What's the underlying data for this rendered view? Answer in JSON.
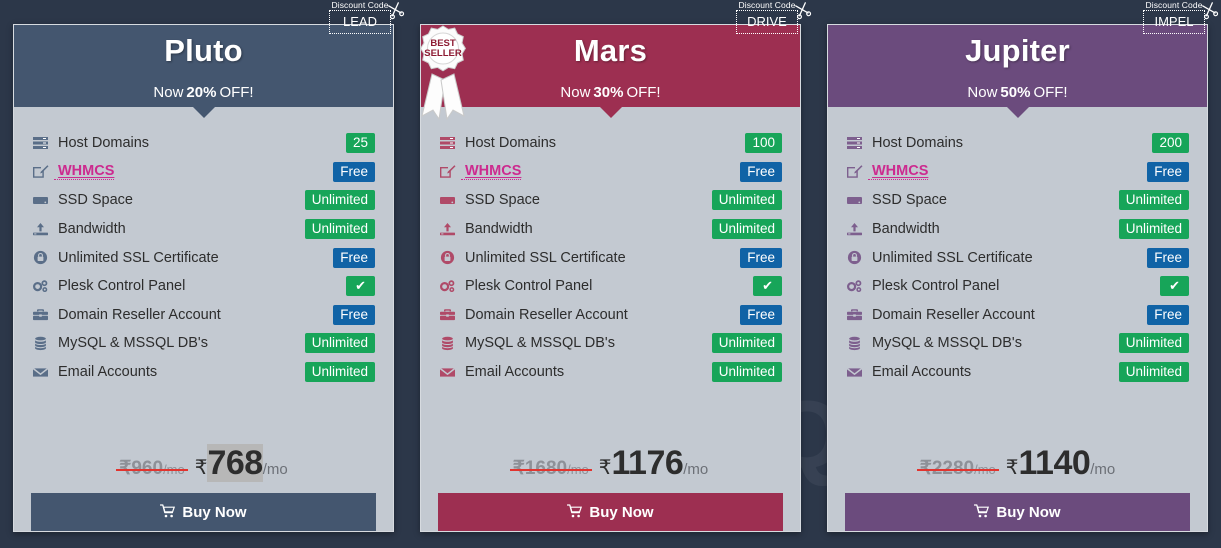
{
  "page": {
    "background_color": "#2c3749",
    "watermark_text": "SQLServer",
    "watermark_sup": "®"
  },
  "labels": {
    "discount_code": "Discount Code",
    "buy_now": "Buy Now",
    "now_prefix": "Now",
    "off_suffix": "OFF!",
    "per_month": "/mo",
    "rupee": "₹",
    "best_seller_line1": "BEST",
    "best_seller_line2": "SELLER",
    "scissors_icon": "scissors-icon",
    "cart_icon": "cart-icon",
    "check_icon": "check-icon"
  },
  "feature_rows": [
    {
      "name": "Host Domains",
      "icon": "server-icon"
    },
    {
      "name": "WHMCS",
      "icon": "edit-icon",
      "highlight": true
    },
    {
      "name": "SSD Space",
      "icon": "hdd-icon"
    },
    {
      "name": "Bandwidth",
      "icon": "upload-icon"
    },
    {
      "name": "Unlimited SSL Certificate",
      "icon": "lock-icon"
    },
    {
      "name": "Plesk Control Panel",
      "icon": "gears-icon"
    },
    {
      "name": "Domain Reseller Account",
      "icon": "briefcase-icon"
    },
    {
      "name": "MySQL & MSSQL DB's",
      "icon": "database-icon"
    },
    {
      "name": "Email Accounts",
      "icon": "envelope-icon"
    }
  ],
  "plans": [
    {
      "id": "pluto",
      "title": "Pluto",
      "discount_code": "LEAD",
      "discount_percent": "20%",
      "theme_color": "#44566f",
      "sub_color": "#44566f",
      "icon_color": "#5a6e88",
      "button_color": "#44566f",
      "best_seller": false,
      "old_price": "960",
      "new_price": "768",
      "price_selected": true,
      "values": [
        {
          "text": "25",
          "style": "green"
        },
        {
          "text": "Free",
          "style": "blue"
        },
        {
          "text": "Unlimited",
          "style": "green"
        },
        {
          "text": "Unlimited",
          "style": "green"
        },
        {
          "text": "Free",
          "style": "blue"
        },
        {
          "text": "✔",
          "style": "check"
        },
        {
          "text": "Free",
          "style": "blue"
        },
        {
          "text": "Unlimited",
          "style": "green"
        },
        {
          "text": "Unlimited",
          "style": "green"
        }
      ]
    },
    {
      "id": "mars",
      "title": "Mars",
      "discount_code": "DRIVE",
      "discount_percent": "30%",
      "theme_color": "#9d2f51",
      "sub_color": "#9d2f51",
      "icon_color": "#b04a68",
      "button_color": "#9d2f51",
      "best_seller": true,
      "old_price": "1680",
      "new_price": "1176",
      "price_selected": false,
      "values": [
        {
          "text": "100",
          "style": "green"
        },
        {
          "text": "Free",
          "style": "blue"
        },
        {
          "text": "Unlimited",
          "style": "green"
        },
        {
          "text": "Unlimited",
          "style": "green"
        },
        {
          "text": "Free",
          "style": "blue"
        },
        {
          "text": "✔",
          "style": "check"
        },
        {
          "text": "Free",
          "style": "blue"
        },
        {
          "text": "Unlimited",
          "style": "green"
        },
        {
          "text": "Unlimited",
          "style": "green"
        }
      ]
    },
    {
      "id": "jupiter",
      "title": "Jupiter",
      "discount_code": "IMPEL",
      "discount_percent": "50%",
      "theme_color": "#6b4b7d",
      "sub_color": "#6b4b7d",
      "icon_color": "#7d5f8e",
      "button_color": "#6b4b7d",
      "best_seller": false,
      "old_price": "2280",
      "new_price": "1140",
      "price_selected": false,
      "values": [
        {
          "text": "200",
          "style": "green"
        },
        {
          "text": "Free",
          "style": "blue"
        },
        {
          "text": "Unlimited",
          "style": "green"
        },
        {
          "text": "Unlimited",
          "style": "green"
        },
        {
          "text": "Free",
          "style": "blue"
        },
        {
          "text": "✔",
          "style": "check"
        },
        {
          "text": "Free",
          "style": "blue"
        },
        {
          "text": "Unlimited",
          "style": "green"
        },
        {
          "text": "Unlimited",
          "style": "green"
        }
      ]
    }
  ]
}
